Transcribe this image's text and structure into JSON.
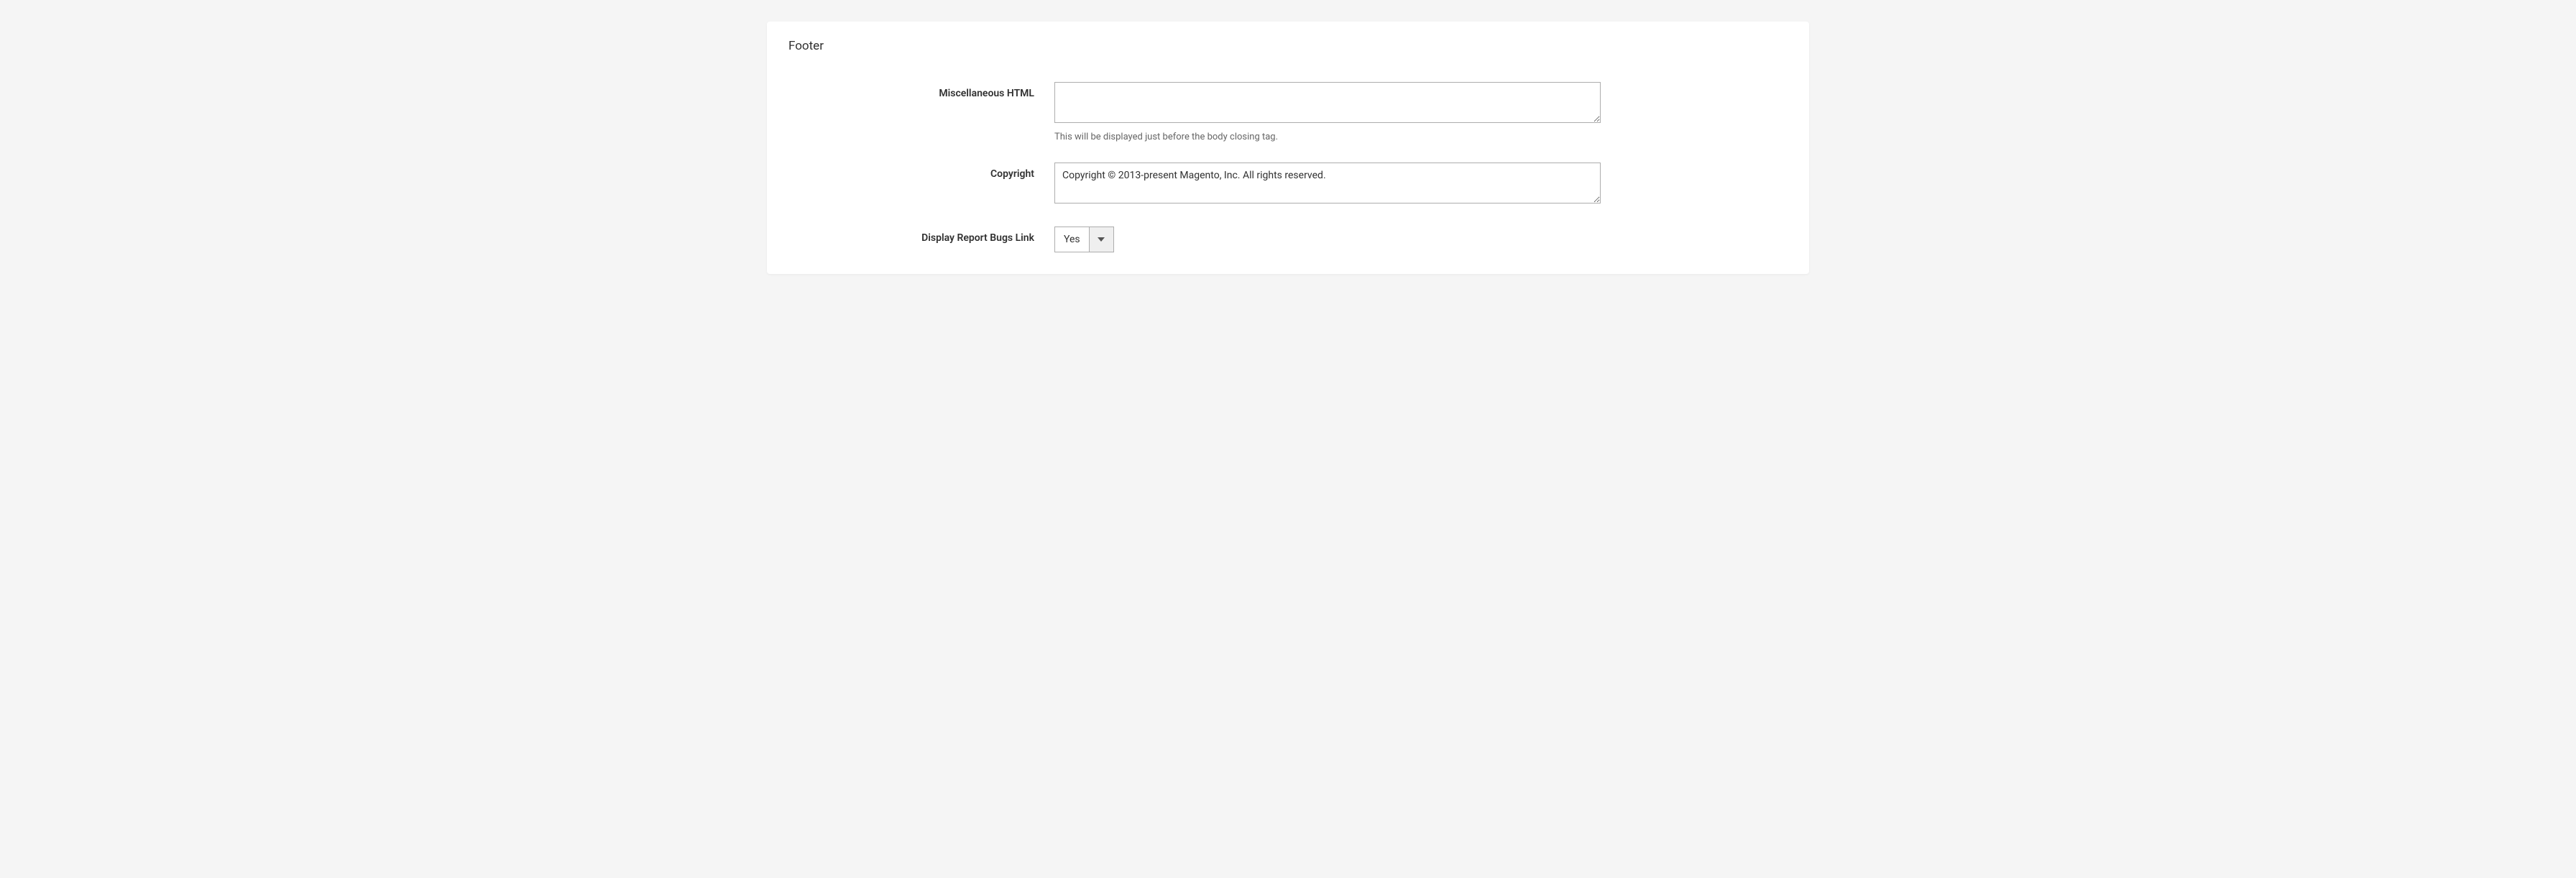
{
  "panel": {
    "title": "Footer",
    "misc_html": {
      "label": "Miscellaneous HTML",
      "value": "",
      "hint": "This will be displayed just before the body closing tag."
    },
    "copyright": {
      "label": "Copyright",
      "value": "Copyright © 2013-present Magento, Inc. All rights reserved."
    },
    "display_report_bugs": {
      "label": "Display Report Bugs Link",
      "value": "Yes"
    }
  }
}
